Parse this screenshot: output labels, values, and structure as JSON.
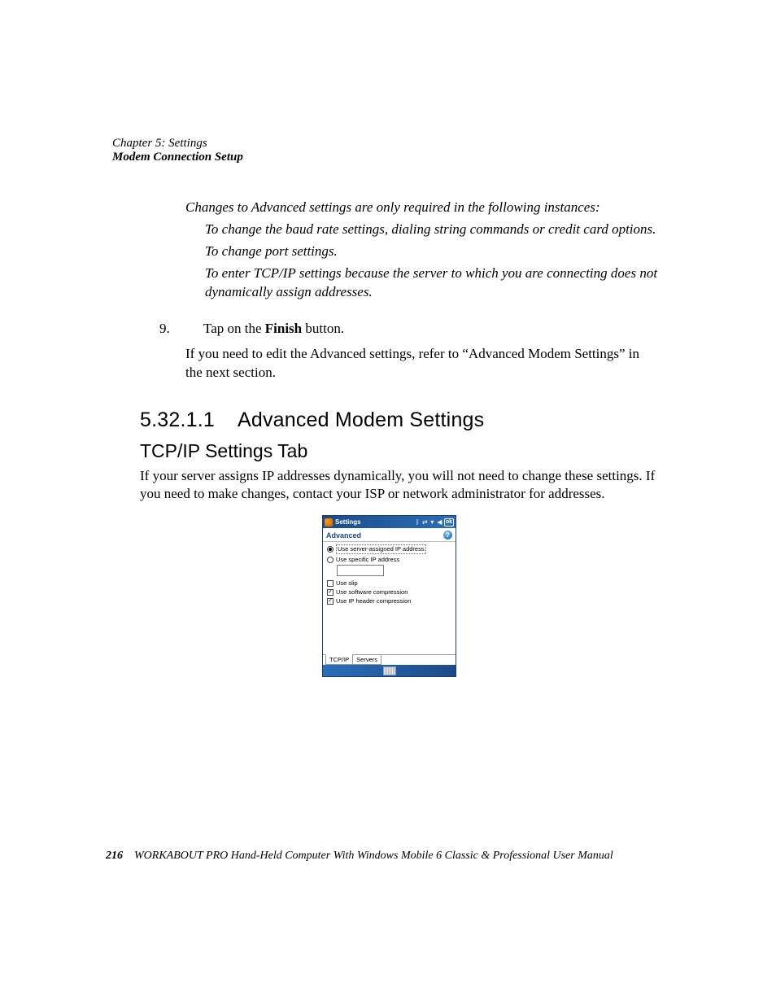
{
  "header": {
    "chapter": "Chapter 5: Settings",
    "section": "Modem Connection Setup"
  },
  "italic_intro": "Changes to Advanced settings are only required in the following instances:",
  "italic_items": {
    "a": "To change the baud rate settings, dialing string commands or credit card options.",
    "b": "To change port settings.",
    "c": "To enter TCP/IP settings because the server to which you are connecting does not dynamically assign addresses."
  },
  "step9": {
    "num": "9.",
    "pre": "Tap on the ",
    "bold": "Finish",
    "post": " button."
  },
  "after_step": "If you need to edit the Advanced settings, refer to “Advanced Modem Settings” in the next section.",
  "heading": {
    "num": "5.32.1.1",
    "title": "Advanced Modem Settings"
  },
  "subheading": "TCP/IP Settings Tab",
  "paragraph": "If your server assigns IP addresses dynamically, you will not need to change these settings. If you need to make changes, contact your ISP or network administrator for addresses.",
  "wm": {
    "title": "Settings",
    "ok": "ok",
    "panel_title": "Advanced",
    "help": "?",
    "radio1": "Use server-assigned IP address",
    "radio2": "Use specific IP address",
    "check_slip": "Use slip",
    "check_sw": "Use software compression",
    "check_iphdr": "Use IP header compression",
    "tab_tcpip": "TCP/IP",
    "tab_servers": "Servers"
  },
  "footer": {
    "page": "216",
    "title": "WORKABOUT PRO Hand-Held Computer With Windows Mobile 6 Classic & Professional User Manual"
  }
}
